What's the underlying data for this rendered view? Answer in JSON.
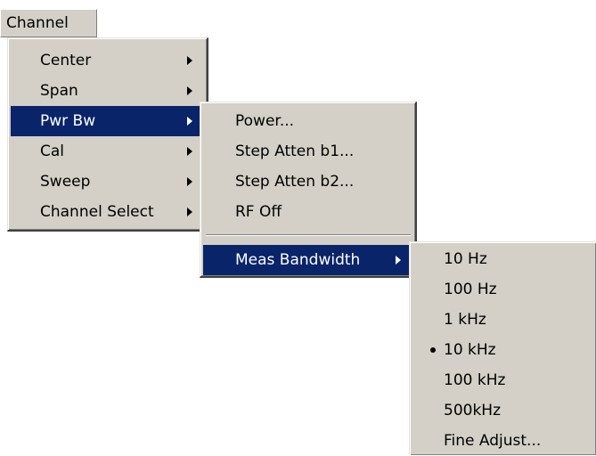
{
  "menubar": {
    "channel_label": "Channel"
  },
  "channel_menu": {
    "items": [
      {
        "label": "Center",
        "submenu": true
      },
      {
        "label": "Span",
        "submenu": true
      },
      {
        "label": "Pwr Bw",
        "submenu": true,
        "highlighted": true
      },
      {
        "label": "Cal",
        "submenu": true
      },
      {
        "label": "Sweep",
        "submenu": true
      },
      {
        "label": "Channel Select",
        "submenu": true
      }
    ]
  },
  "pwr_bw_menu": {
    "items": [
      {
        "label": "Power..."
      },
      {
        "label": "Step Atten b1..."
      },
      {
        "label": "Step Atten b2..."
      },
      {
        "label": "RF Off"
      },
      {
        "label": "Meas Bandwidth",
        "submenu": true,
        "highlighted": true
      }
    ]
  },
  "bandwidth_menu": {
    "items": [
      {
        "label": "10 Hz"
      },
      {
        "label": "100 Hz"
      },
      {
        "label": "1 kHz"
      },
      {
        "label": "10 kHz",
        "checked": true
      },
      {
        "label": "100 kHz"
      },
      {
        "label": "500kHz"
      },
      {
        "label": "Fine Adjust..."
      }
    ]
  },
  "colors": {
    "menu_bg": "#d4d0c8",
    "highlight_bg": "#0a246a",
    "highlight_fg": "#ffffff"
  }
}
